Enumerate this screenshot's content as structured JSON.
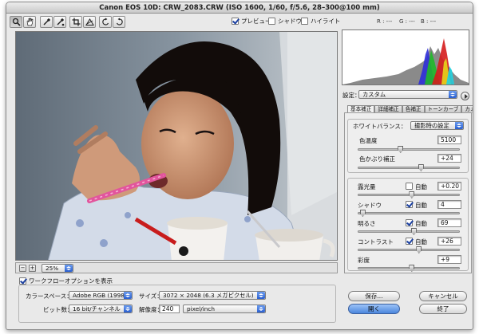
{
  "window": {
    "title": "Canon EOS 10D:  CRW_2083.CRW  (ISO 1600, 1/60, f/5.6, 28–300@100 mm)"
  },
  "toolbar": {
    "tools": [
      "zoom-tool",
      "hand-tool",
      "white-balance-tool",
      "color-sampler-tool",
      "crop-tool",
      "straighten-tool",
      "rotate-left",
      "rotate-right"
    ],
    "preview_label": "プレビュー",
    "shadows_label": "シャドウ",
    "highlights_label": "ハイライト",
    "preview_checked": true,
    "shadows_checked": false,
    "highlights_checked": false
  },
  "readout": {
    "r": "R : ---",
    "g": "G : ---",
    "b": "B : ---"
  },
  "settings": {
    "label": "設定：",
    "value": "カスタム"
  },
  "tabs": [
    "基本補正",
    "詳細補正",
    "色補正",
    "トーンカーブ",
    "カメラ補正"
  ],
  "white_balance": {
    "label": "ホワイトバランス：",
    "value": "撮影時の設定",
    "temperature_label": "色温度",
    "temperature_value": "5100",
    "temperature_level": 0.42,
    "tint_label": "色かぶり補正",
    "tint_value": "+24",
    "tint_level": 0.62
  },
  "adjustments": [
    {
      "label": "露光量",
      "auto": false,
      "value": "+0.20",
      "level": 0.53
    },
    {
      "label": "シャドウ",
      "auto": true,
      "value": "4",
      "level": 0.05
    },
    {
      "label": "明るさ",
      "auto": true,
      "value": "69",
      "level": 0.55
    },
    {
      "label": "コントラスト",
      "auto": true,
      "value": "+26",
      "level": 0.6
    },
    {
      "label": "彩度",
      "auto": false,
      "value": "+9",
      "level": 0.53
    }
  ],
  "auto_label": "自動",
  "zoom": {
    "value": "25%"
  },
  "workflow": {
    "show_label": "ワークフローオプションを表示",
    "show_checked": true,
    "colorspace_label": "カラースペース：",
    "colorspace_value": "Adobe RGB (1998)",
    "size_label": "サイズ：",
    "size_value": "3072 × 2048 (6.3 メガピクセル)",
    "depth_label": "ビット数：",
    "depth_value": "16 bit/チャンネル",
    "resolution_label": "解像度：",
    "resolution_value": "240",
    "resolution_unit": "pixel/inch"
  },
  "buttons": {
    "save": "保存...",
    "cancel": "キャンセル",
    "open": "開く",
    "done": "終了"
  },
  "colors": {
    "accent": "#4a86dd",
    "panel": "#e9e9e9"
  }
}
